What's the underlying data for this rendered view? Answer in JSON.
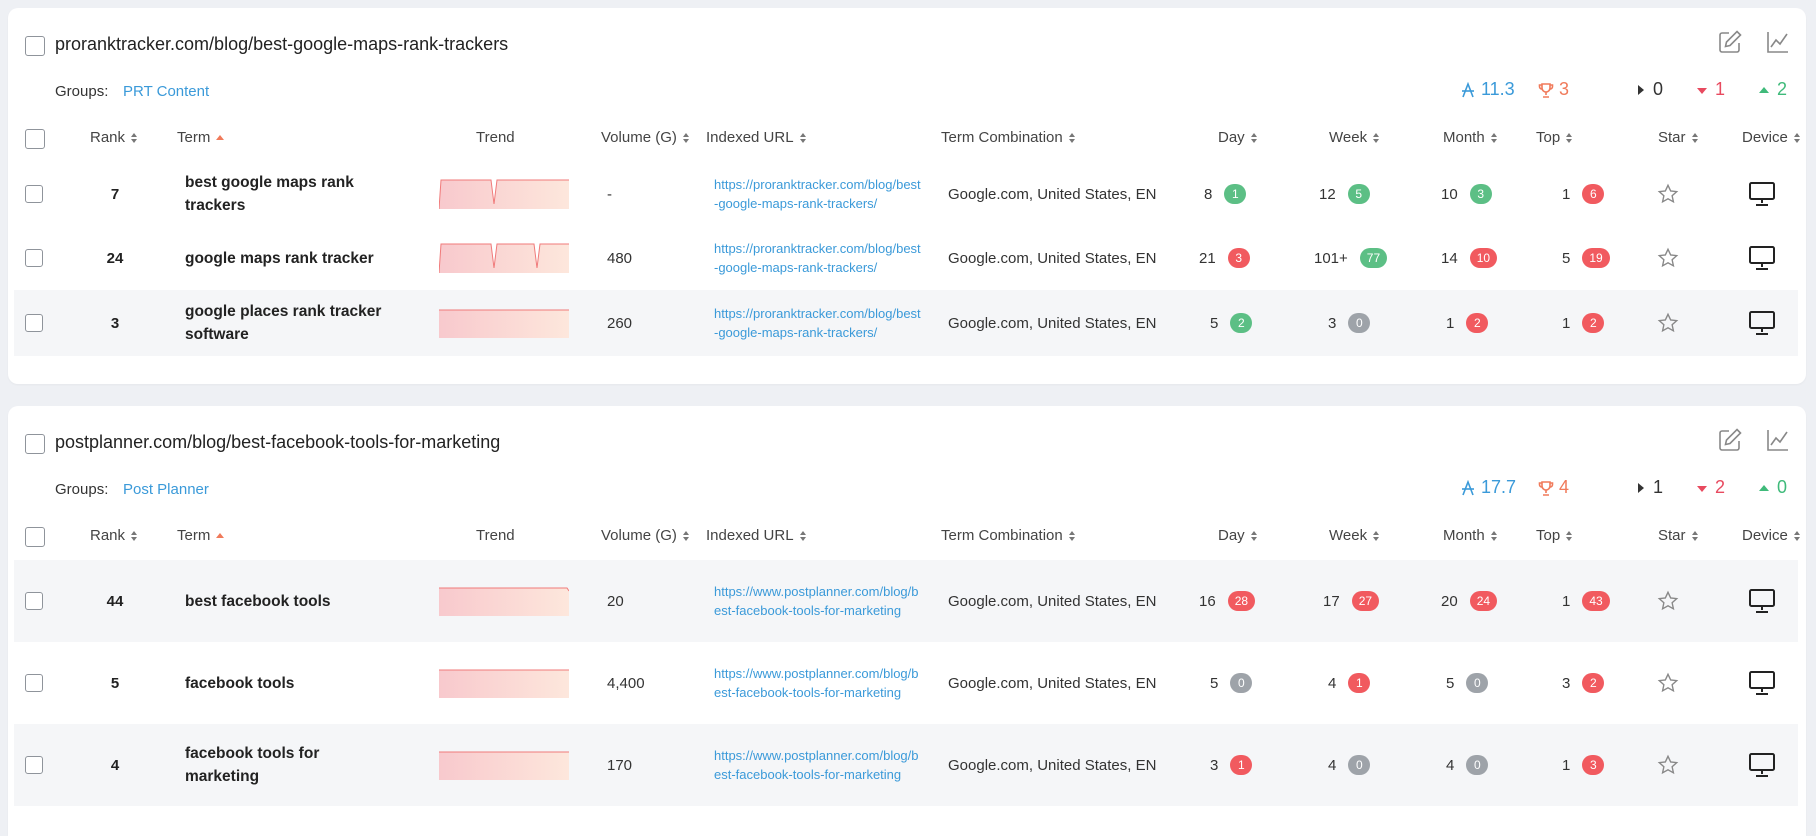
{
  "columns": {
    "rank": "Rank",
    "term": "Term",
    "trend": "Trend",
    "volume": "Volume (G)",
    "indexed_url": "Indexed URL",
    "term_combination": "Term Combination",
    "day": "Day",
    "week": "Week",
    "month": "Month",
    "top": "Top",
    "star": "Star",
    "device": "Device"
  },
  "colors": {
    "link": "#3b9ad9",
    "green": "#5cbf85",
    "red": "#f15a5f",
    "gray": "#9ea3a9",
    "trend_line": "#f07a7a"
  },
  "cards": [
    {
      "title": "proranktracker.com/blog/best-google-maps-rank-trackers",
      "groups_label": "Groups:",
      "groups_value": "PRT Content",
      "stats": {
        "avg": "11.3",
        "top": "3",
        "same": "0",
        "down": "1",
        "up": "2"
      },
      "rows": [
        {
          "rank": "7",
          "term": "best google maps rank trackers",
          "volume": "-",
          "url": "https://proranktracker.com/blog/best-google-maps-rank-trackers/",
          "combo": "Google.com, United States, EN",
          "day": "8",
          "day_badge": "1",
          "day_color": "green",
          "week": "12",
          "week_badge": "5",
          "week_color": "green",
          "month": "10",
          "month_badge": "3",
          "month_color": "green",
          "top": "1",
          "top_badge": "6",
          "top_color": "red",
          "trend": "dip1",
          "star_icon": "star-outline-icon",
          "device_icon": "desktop-icon"
        },
        {
          "rank": "24",
          "term": "google maps rank tracker",
          "volume": "480",
          "url": "https://proranktracker.com/blog/best-google-maps-rank-trackers/",
          "combo": "Google.com, United States, EN",
          "day": "21",
          "day_badge": "3",
          "day_color": "red",
          "week": "101+",
          "week_badge": "77",
          "week_color": "green",
          "month": "14",
          "month_badge": "10",
          "month_color": "red",
          "top": "5",
          "top_badge": "19",
          "top_color": "red",
          "trend": "dip2",
          "star_icon": "star-outline-icon",
          "device_icon": "desktop-icon"
        },
        {
          "rank": "3",
          "term": "google places rank tracker software",
          "volume": "260",
          "url": "https://proranktracker.com/blog/best-google-maps-rank-trackers/",
          "combo": "Google.com, United States, EN",
          "day": "5",
          "day_badge": "2",
          "day_color": "green",
          "week": "3",
          "week_badge": "0",
          "week_color": "gray",
          "month": "1",
          "month_badge": "2",
          "month_color": "red",
          "top": "1",
          "top_badge": "2",
          "top_color": "red",
          "trend": "flat",
          "star_icon": "star-outline-icon",
          "device_icon": "desktop-icon"
        }
      ]
    },
    {
      "title": "postplanner.com/blog/best-facebook-tools-for-marketing",
      "groups_label": "Groups:",
      "groups_value": "Post Planner",
      "stats": {
        "avg": "17.7",
        "top": "4",
        "same": "1",
        "down": "2",
        "up": "0"
      },
      "rows": [
        {
          "rank": "44",
          "term": "best facebook tools",
          "volume": "20",
          "url": "https://www.postplanner.com/blog/best-facebook-tools-for-marketing",
          "combo": "Google.com, United States, EN",
          "day": "16",
          "day_badge": "28",
          "day_color": "red",
          "week": "17",
          "week_badge": "27",
          "week_color": "red",
          "month": "20",
          "month_badge": "24",
          "month_color": "red",
          "top": "1",
          "top_badge": "43",
          "top_color": "red",
          "trend": "flat",
          "star_icon": "star-outline-icon",
          "device_icon": "desktop-icon"
        },
        {
          "rank": "5",
          "term": "facebook tools",
          "volume": "4,400",
          "url": "https://www.postplanner.com/blog/best-facebook-tools-for-marketing",
          "combo": "Google.com, United States, EN",
          "day": "5",
          "day_badge": "0",
          "day_color": "gray",
          "week": "4",
          "week_badge": "1",
          "week_color": "red",
          "month": "5",
          "month_badge": "0",
          "month_color": "gray",
          "top": "3",
          "top_badge": "2",
          "top_color": "red",
          "trend": "flat",
          "star_icon": "star-outline-icon",
          "device_icon": "desktop-icon"
        },
        {
          "rank": "4",
          "term": "facebook tools for marketing",
          "volume": "170",
          "url": "https://www.postplanner.com/blog/best-facebook-tools-for-marketing",
          "combo": "Google.com, United States, EN",
          "day": "3",
          "day_badge": "1",
          "day_color": "red",
          "week": "4",
          "week_badge": "0",
          "week_color": "gray",
          "month": "4",
          "month_badge": "0",
          "month_color": "gray",
          "top": "1",
          "top_badge": "3",
          "top_color": "red",
          "trend": "flat",
          "star_icon": "star-outline-icon",
          "device_icon": "desktop-icon"
        }
      ]
    }
  ]
}
